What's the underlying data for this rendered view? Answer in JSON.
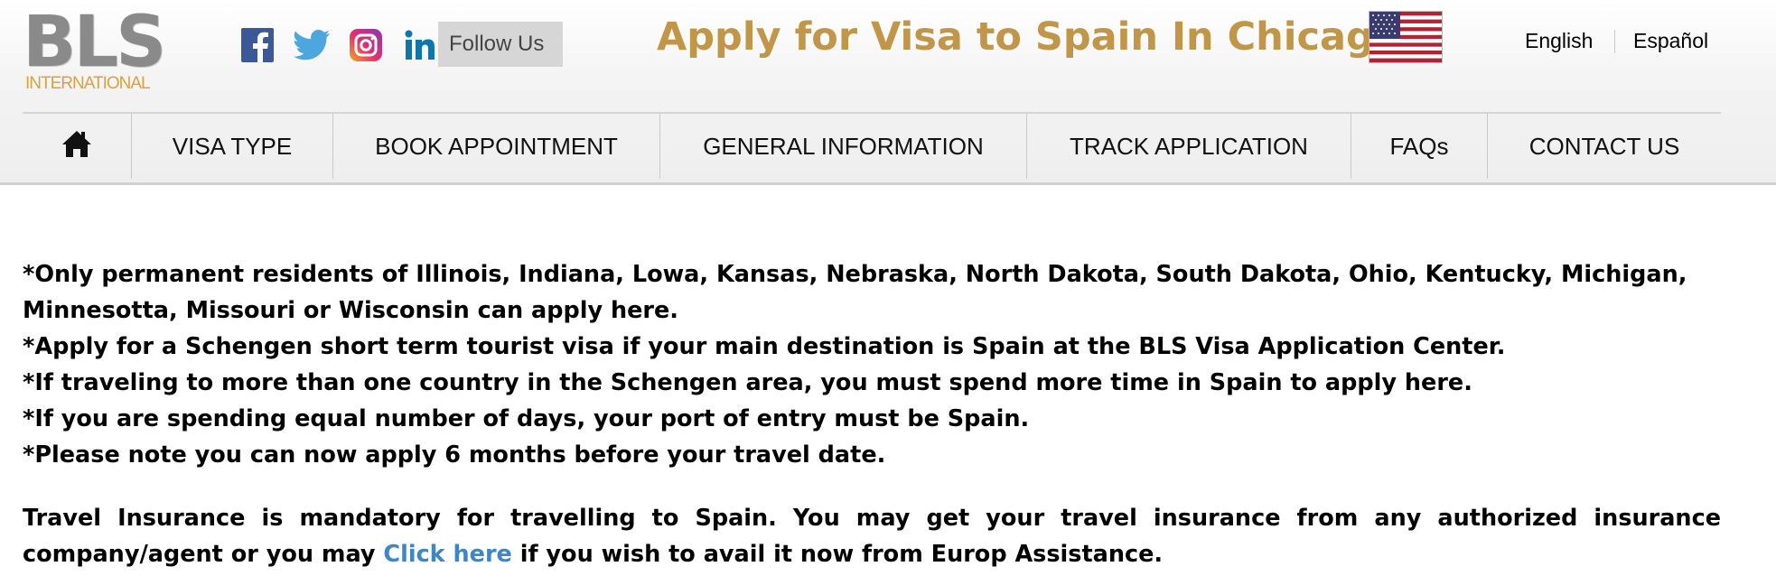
{
  "header": {
    "logo": {
      "mark": "BLS",
      "sub": "INTERNATIONAL"
    },
    "social": {
      "icons": [
        "facebook-icon",
        "twitter-icon",
        "instagram-icon",
        "linkedin-icon"
      ],
      "follow_label": "Follow Us"
    },
    "title": "Apply for Visa to Spain In Chicago",
    "flag": "us-flag-icon",
    "languages": [
      "English",
      "Español"
    ]
  },
  "nav": {
    "home_icon": "home-icon",
    "items": [
      "VISA TYPE",
      "BOOK APPOINTMENT",
      "GENERAL INFORMATION",
      "TRACK APPLICATION",
      "FAQs",
      "CONTACT US"
    ]
  },
  "main": {
    "notes": [
      "*Only permanent residents of Illinois, Indiana, Lowa, Kansas, Nebraska, North Dakota, South Dakota, Ohio, Kentucky, Michigan, Minnesotta, Missouri or Wisconsin can apply here.",
      "*Apply for a Schengen short term tourist visa if your main destination is Spain at the BLS Visa Application Center.",
      "*If traveling to more than one country in the Schengen area, you must spend more time in Spain to apply here.",
      "*If you are spending equal number of days, your port of entry must be Spain.",
      "*Please note you can now apply 6 months before your travel date."
    ],
    "insurance": {
      "before": "Travel Insurance is mandatory for travelling to Spain. You may get your travel insurance from any authorized insurance company/agent or you may ",
      "link": "Click here",
      "after": " if you wish to avail it now from Europ Assistance."
    }
  },
  "colors": {
    "title": "#c19649",
    "logo_gray": "#8a8a8a",
    "logo_gold": "#d9a23f",
    "link": "#3f86c6",
    "follow_bg": "#d6d6d6"
  }
}
